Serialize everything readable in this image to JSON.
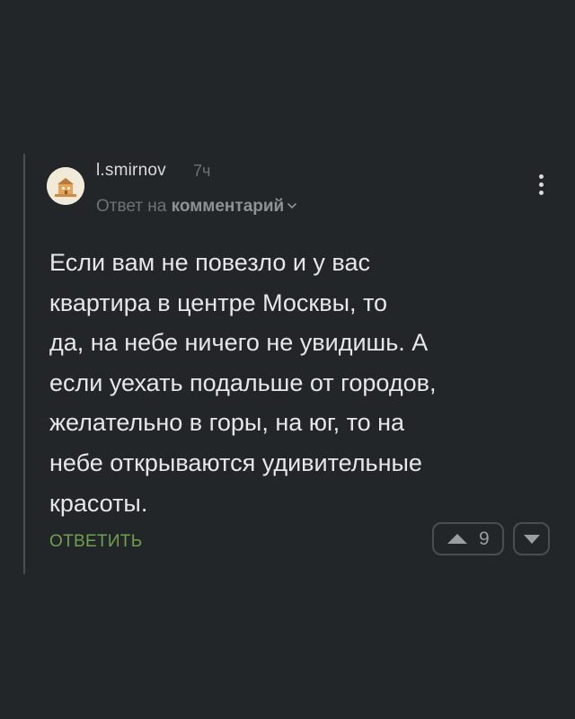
{
  "comment": {
    "username": "l.smirnov",
    "time": "7ч",
    "reply_to_prefix": "Ответ на",
    "reply_to_link": "комментарий",
    "text": "Если вам не повезло и у вас\nквартира в центре Москвы, то\nда, на небе ничего не увидишь. А\nесли уехать подальше от городов,\nжелательно в горы, на юг, то на\nнебе открываются удивительные\nкрасоты.",
    "reply_button": "ОТВЕТИТЬ",
    "rating": "9"
  },
  "icons": {
    "avatar": "avatar-image",
    "more": "more-vertical-icon",
    "chevron": "chevron-down-icon",
    "upvote": "upvote-arrow-icon",
    "downvote": "downvote-arrow-icon"
  },
  "colors": {
    "background": "#232629",
    "text": "#e6e7e8",
    "muted": "#6e7277",
    "accent_green": "#6da14f",
    "border": "#4a4e53"
  }
}
